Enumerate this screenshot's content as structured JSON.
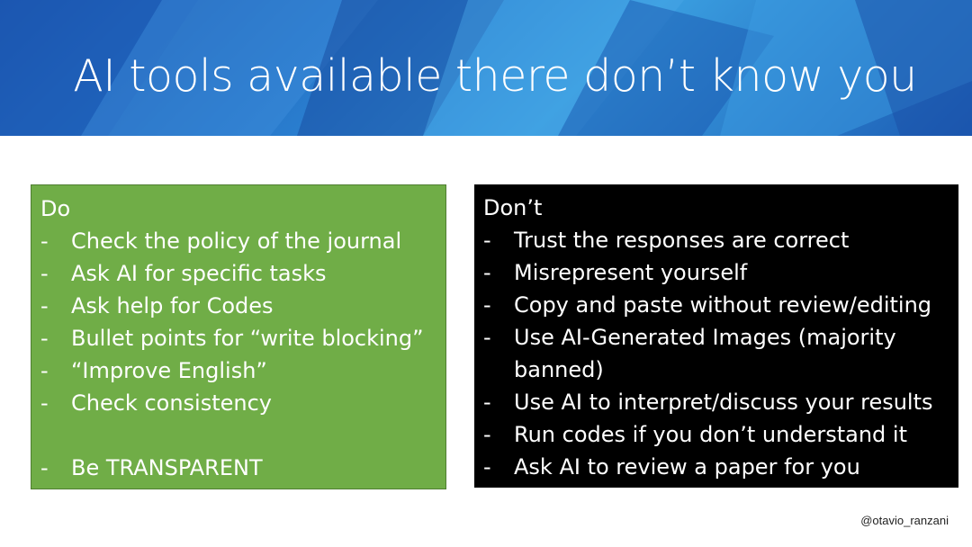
{
  "slide": {
    "title": "AI tools available there don’t know you",
    "credit": "@otavio_ranzani"
  },
  "do_panel": {
    "heading": "Do",
    "items": [
      "Check the policy of the journal",
      "Ask AI for specific tasks",
      "Ask help for Codes",
      "Bullet points for “write blocking”",
      "“Improve English”",
      "Check consistency",
      "Be TRANSPARENT"
    ]
  },
  "dont_panel": {
    "heading": "Don’t",
    "items": [
      "Trust the responses are correct",
      "Misrepresent yourself",
      "Copy and paste without review/editing",
      "Use AI-Generated Images (majority banned)",
      "Use AI to interpret/discuss your results",
      "Run codes if you don’t understand it",
      "Ask AI to review a paper for you"
    ]
  },
  "colors": {
    "do_background": "#70ad47",
    "dont_background": "#000000",
    "banner_blue": "#2a7fd0"
  }
}
